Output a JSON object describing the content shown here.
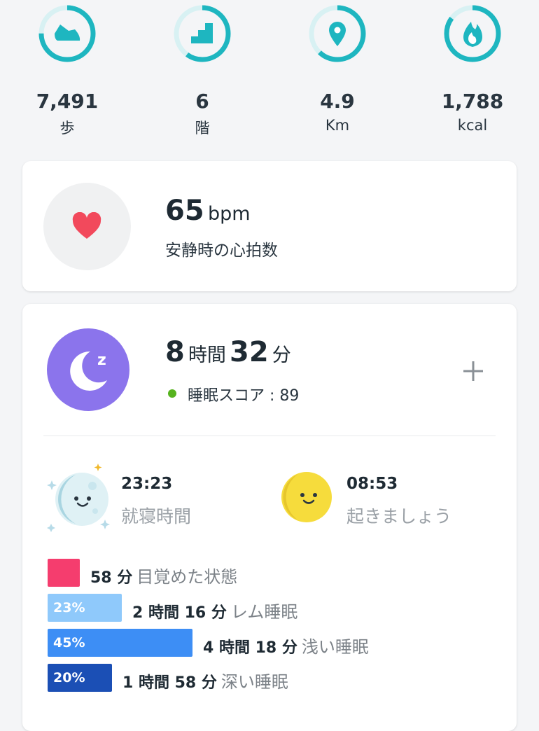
{
  "stats": [
    {
      "icon": "shoe-icon",
      "value": "7,491",
      "unit": "歩",
      "progress": 0.75
    },
    {
      "icon": "stairs-icon",
      "value": "6",
      "unit": "階",
      "progress": 0.6
    },
    {
      "icon": "location-pin-icon",
      "value": "4.9",
      "unit": "Km",
      "progress": 0.62
    },
    {
      "icon": "flame-icon",
      "value": "1,788",
      "unit": "kcal",
      "progress": 0.85
    }
  ],
  "heart_rate": {
    "value": "65",
    "unit": "bpm",
    "label": "安静時の心拍数"
  },
  "sleep": {
    "hours": "8",
    "hours_unit": "時間",
    "minutes": "32",
    "minutes_unit": "分",
    "score_label": "睡眠スコア : 89",
    "bedtime": {
      "time": "23:23",
      "label": "就寝時間"
    },
    "wake": {
      "time": "08:53",
      "label": "起きましょう"
    },
    "stages": [
      {
        "pct": "",
        "fraction": 0.0,
        "duration": "58 分",
        "name": "目覚めた状態",
        "color": "#f53d6e"
      },
      {
        "pct": "23%",
        "fraction": 0.23,
        "duration": "2 時間 16 分",
        "name": "レム睡眠",
        "color": "#8fc9fb"
      },
      {
        "pct": "45%",
        "fraction": 0.45,
        "duration": "4 時間 18 分",
        "name": "浅い睡眠",
        "color": "#3d8ef5"
      },
      {
        "pct": "20%",
        "fraction": 0.2,
        "duration": "1 時間 58 分",
        "name": "深い睡眠",
        "color": "#1b4fb5"
      }
    ]
  },
  "colors": {
    "ring": "#1eb6c0",
    "ring_track": "#d8f1f3",
    "heart": "#f2495c",
    "sleep_purple": "#8b74ec",
    "score_green": "#56b31e"
  }
}
